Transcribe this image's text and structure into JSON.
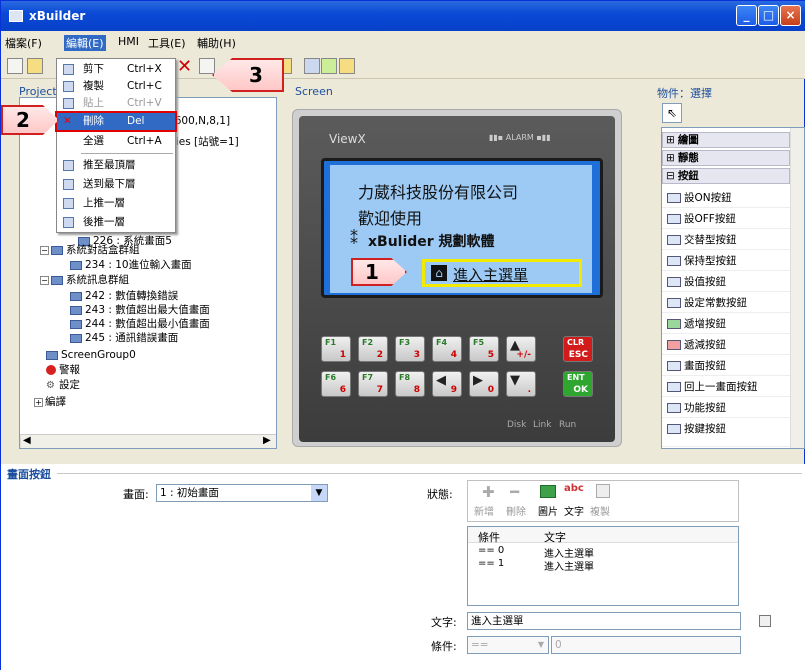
{
  "window": {
    "title": "xBuilder",
    "min": "_",
    "max": "□",
    "close": "×"
  },
  "menu": [
    "檔案(F)",
    "編輯(E)",
    "HMI",
    "工具(E)",
    "輔助(H)"
  ],
  "project_panel": {
    "tab": "Project",
    "items": [
      {
        "text": "Mode [9600,N,8,1]",
        "indent": 0
      },
      {
        "text": "oller Series [站號=1]",
        "indent": 0
      },
      {
        "text": "226 : 系統畫面5",
        "indent": 2
      },
      {
        "text": "系統對話盒群組",
        "indent": 1
      },
      {
        "text": "234 : 10進位輸入畫面",
        "indent": 2
      },
      {
        "text": "系統訊息群組",
        "indent": 1
      },
      {
        "text": "242 : 數值轉換錯誤",
        "indent": 2
      },
      {
        "text": "243 : 數值超出最大值畫面",
        "indent": 2
      },
      {
        "text": "244 : 數值超出最小值畫面",
        "indent": 2
      },
      {
        "text": "245 : 通訊錯誤畫面",
        "indent": 2
      },
      {
        "text": "ScreenGroup0",
        "indent": 1
      },
      {
        "text": "警報",
        "indent": 1
      },
      {
        "text": "設定",
        "indent": 1
      },
      {
        "text": "編譯",
        "indent": 0
      }
    ]
  },
  "context_menu": {
    "items": [
      {
        "label": "剪下",
        "shortcut": "Ctrl+X"
      },
      {
        "label": "複製",
        "shortcut": "Ctrl+C"
      },
      {
        "label": "貼上",
        "shortcut": "Ctrl+V"
      },
      {
        "label": "刪除",
        "shortcut": "Del"
      },
      {
        "label": "全選",
        "shortcut": "Ctrl+A"
      },
      {
        "label": "推至最頂層",
        "shortcut": ""
      },
      {
        "label": "送到最下層",
        "shortcut": ""
      },
      {
        "label": "上推一層",
        "shortcut": ""
      },
      {
        "label": "後推一層",
        "shortcut": ""
      }
    ]
  },
  "screen_panel": {
    "tab": "Screen",
    "brand": "ViewX",
    "alarm": "ALARM",
    "lcd_lines": [
      "力葳科技股份有限公司",
      "歡迎使用",
      "xBulider 規劃軟體",
      "進入主選單"
    ],
    "keys_row1": [
      {
        "t": "F1",
        "n": "1"
      },
      {
        "t": "F2",
        "n": "2"
      },
      {
        "t": "F3",
        "n": "3"
      },
      {
        "t": "F4",
        "n": "4"
      },
      {
        "t": "F5",
        "n": "5"
      },
      {
        "t": "▲",
        "n": "+/-"
      },
      {
        "t": "CLR",
        "n": "ESC"
      }
    ],
    "keys_row2": [
      {
        "t": "F6",
        "n": "6"
      },
      {
        "t": "F7",
        "n": "7"
      },
      {
        "t": "F8",
        "n": "8"
      },
      {
        "t": "◀",
        "n": "9"
      },
      {
        "t": "▶",
        "n": "0"
      },
      {
        "t": "▼",
        "n": "."
      },
      {
        "t": "ENT",
        "n": "OK"
      }
    ],
    "leds": [
      "Disk",
      "Link",
      "Run"
    ]
  },
  "objects_panel": {
    "title": "物件：選擇",
    "groups": [
      "繪圖",
      "靜態",
      "按鈕"
    ],
    "items": [
      "設ON按鈕",
      "設OFF按鈕",
      "交替型按鈕",
      "保持型按鈕",
      "設值按鈕",
      "設定常數按鈕",
      "遞增按鈕",
      "遞減按鈕",
      "畫面按鈕",
      "回上一畫面按鈕",
      "功能按鈕",
      "按鍵按鈕"
    ]
  },
  "callouts": [
    "1",
    "2",
    "3"
  ],
  "bottom": {
    "section_title": "畫面按鈕",
    "screen_label": "畫面:",
    "screen_value": "1 : 初始畫面",
    "state_label": "狀態:",
    "state_buttons": [
      "新增",
      "刪除",
      "圖片",
      "文字",
      "複製"
    ],
    "table_headers": [
      "條件",
      "文字"
    ],
    "table_rows": [
      [
        "== 0",
        "進入主選單"
      ],
      [
        "== 1",
        "進入主選單"
      ]
    ],
    "text_label": "文字:",
    "text_value": "進入主選單",
    "cond_label": "條件:",
    "cond_value": "==",
    "cond_num": "0"
  }
}
